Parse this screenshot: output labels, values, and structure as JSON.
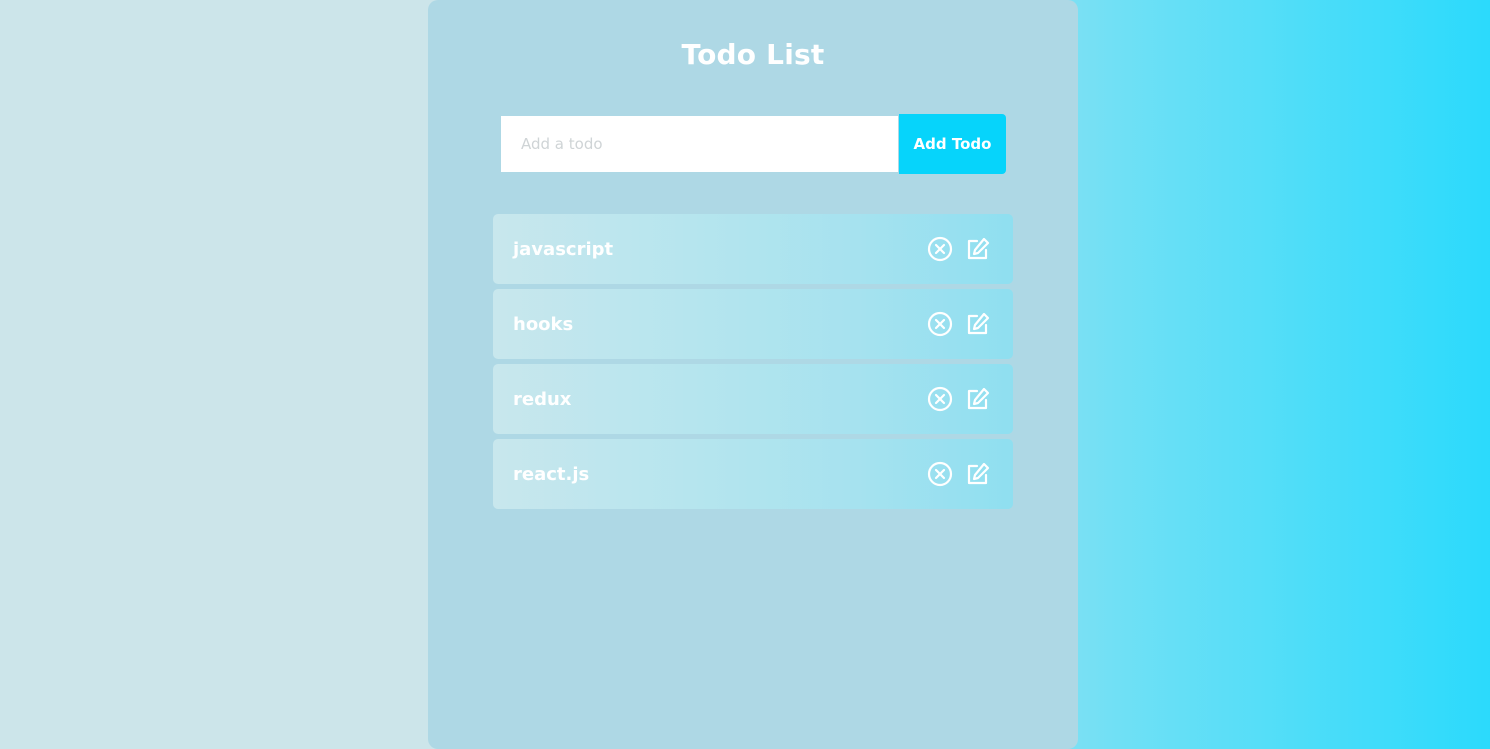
{
  "app": {
    "title": "Todo List"
  },
  "form": {
    "input_placeholder": "Add a todo",
    "input_value": "",
    "add_button_label": "Add Todo"
  },
  "todos": [
    {
      "text": "javascript",
      "delete_icon": "close-circle-icon",
      "edit_icon": "edit-icon"
    },
    {
      "text": "hooks",
      "delete_icon": "close-circle-icon",
      "edit_icon": "edit-icon"
    },
    {
      "text": "redux",
      "delete_icon": "close-circle-icon",
      "edit_icon": "edit-icon"
    },
    {
      "text": "react.js",
      "delete_icon": "close-circle-icon",
      "edit_icon": "edit-icon"
    }
  ],
  "colors": {
    "accent": "#06d4fb",
    "panel": "#aed8e5",
    "text": "#ffffff"
  }
}
